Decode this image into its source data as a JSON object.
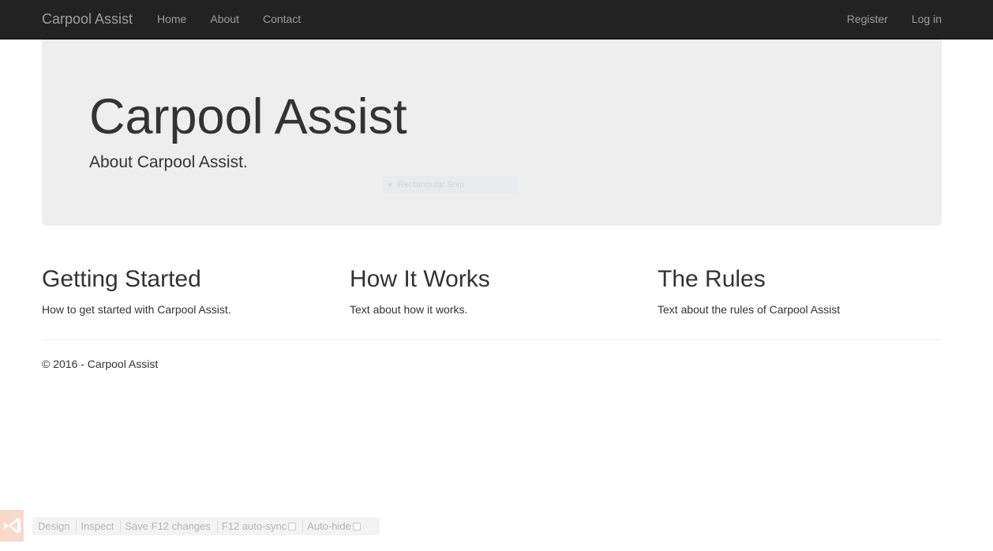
{
  "navbar": {
    "brand": "Carpool Assist",
    "left_links": [
      "Home",
      "About",
      "Contact"
    ],
    "right_links": [
      "Register",
      "Log in"
    ]
  },
  "jumbotron": {
    "title": "Carpool Assist",
    "lead": "About Carpool Assist.",
    "overlay_label": "Rectangular Snip"
  },
  "columns": [
    {
      "heading": "Getting Started",
      "text": "How to get started with Carpool Assist."
    },
    {
      "heading": "How It Works",
      "text": "Text about how it works."
    },
    {
      "heading": "The Rules",
      "text": "Text about the rules of Carpool Assist"
    }
  ],
  "footer": {
    "text": "© 2016 - Carpool Assist"
  },
  "browser_link": {
    "icon": "visual-studio-icon",
    "items": [
      "Design",
      "Inspect",
      "Save F12 changes",
      "F12 auto-sync",
      "Auto-hide"
    ]
  },
  "colors": {
    "navbar_bg": "#222222",
    "nav_text": "#9d9d9d",
    "jumbotron_bg": "#eeeeee",
    "body_text": "#333333"
  }
}
